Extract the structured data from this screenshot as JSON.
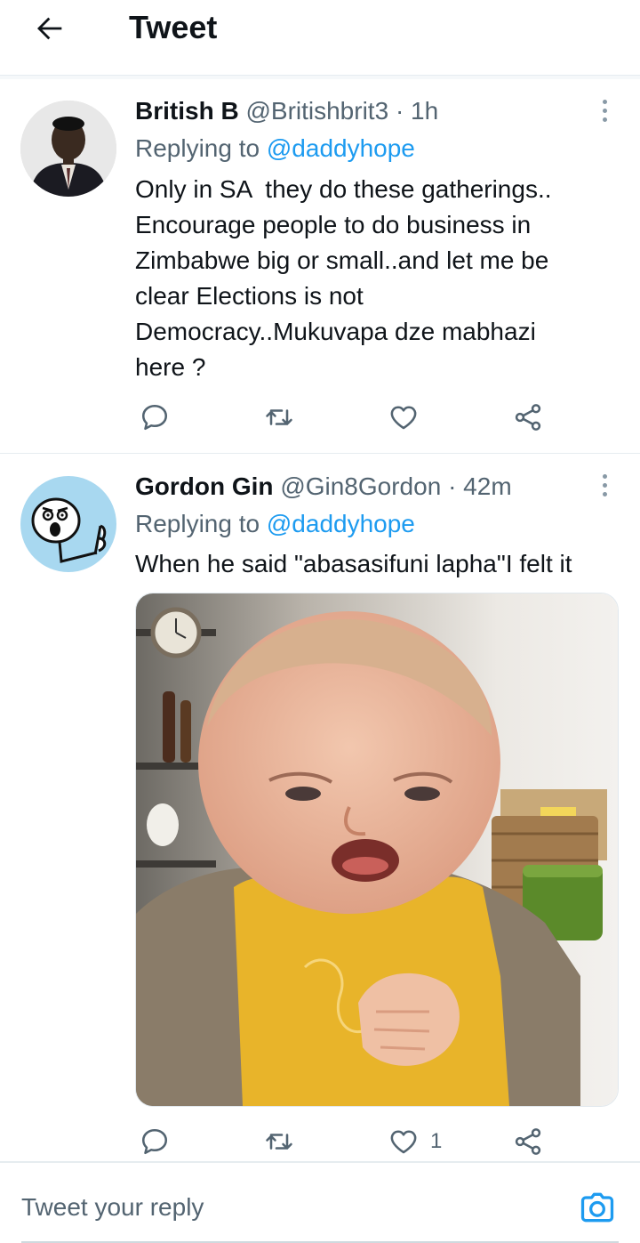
{
  "header": {
    "title": "Tweet",
    "back_icon": "arrow-left-icon"
  },
  "tweets": [
    {
      "name": "British B",
      "handle": "@Britishbrit3",
      "dot": "·",
      "time": "1h",
      "replying_prefix": "Replying to",
      "replying_to": "@daddyhope",
      "text": "Only in SA  they do these gatherings..\nEncourage people to do business in\nZimbabwe big or small..and let me be\nclear Elections is not\nDemocracy..Mukuvapa dze mabhazi\nhere ?",
      "like_count": ""
    },
    {
      "name": "Gordon Gin",
      "handle": "@Gin8Gordon",
      "dot": "·",
      "time": "42m",
      "replying_prefix": "Replying to",
      "replying_to": "@daddyhope",
      "text": "When he said \"abasasifuni lapha\"I felt it",
      "like_count": "1"
    }
  ],
  "reply_bar": {
    "placeholder": "Tweet your reply",
    "camera_icon": "camera-icon"
  },
  "colors": {
    "accent": "#1d9bf0",
    "text": "#0f1419",
    "secondary": "#536471",
    "divider": "#e6ecf0"
  }
}
